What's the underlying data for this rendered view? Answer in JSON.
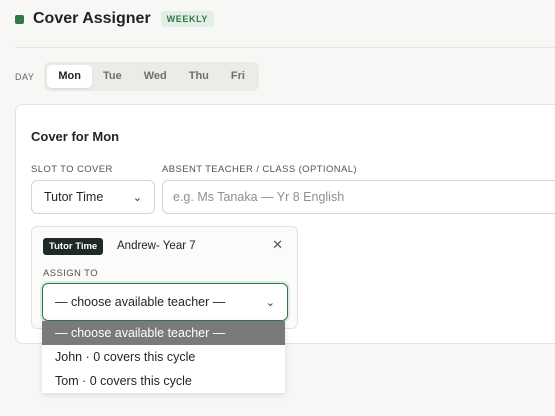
{
  "header": {
    "title": "Cover Assigner",
    "badge": "WEEKLY"
  },
  "days": {
    "label": "DAY",
    "tabs": [
      "Mon",
      "Tue",
      "Wed",
      "Thu",
      "Fri"
    ],
    "active": "Mon"
  },
  "cover": {
    "title": "Cover for Mon",
    "slot_label": "SLOT TO COVER",
    "slot_value": "Tutor Time",
    "absent_label": "ABSENT TEACHER / CLASS (OPTIONAL)",
    "absent_placeholder": "e.g. Ms Tanaka — Yr 8 English",
    "absent_value": ""
  },
  "slot_card": {
    "tag": "Tutor Time",
    "name": "Andrew- Year 7",
    "assign_label": "ASSIGN TO",
    "selected": "— choose available teacher —"
  },
  "dropdown": {
    "options": [
      "— choose available teacher —",
      "John · 0 covers this cycle",
      "Tom · 0 covers this cycle"
    ]
  },
  "icons": {
    "close": "close-icon",
    "chevron": "chevron-down-icon"
  },
  "colors": {
    "accent": "#2f7a48",
    "tag_bg": "#1f2a24"
  }
}
